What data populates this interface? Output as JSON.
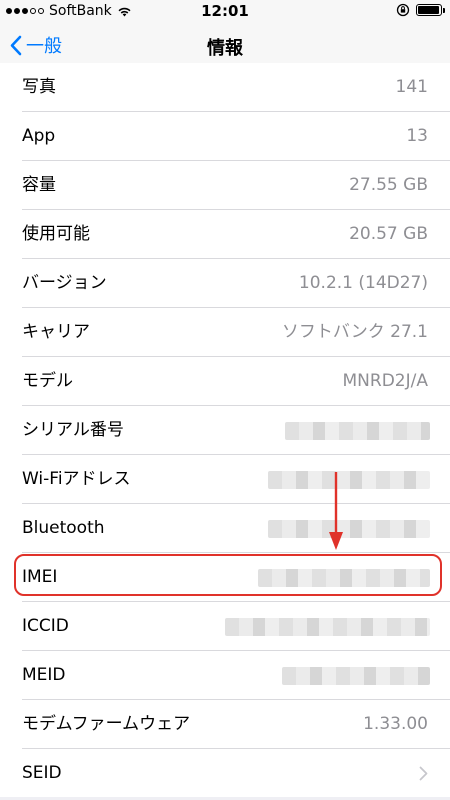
{
  "status_bar": {
    "carrier": "SoftBank",
    "time": "12:01",
    "battery_level": 0.95
  },
  "nav": {
    "back_label": "一般",
    "title": "情報"
  },
  "rows": [
    {
      "label": "写真",
      "value": "141"
    },
    {
      "label": "App",
      "value": "13"
    },
    {
      "label": "容量",
      "value": "27.55 GB"
    },
    {
      "label": "使用可能",
      "value": "20.57 GB"
    },
    {
      "label": "バージョン",
      "value": "10.2.1 (14D27)"
    },
    {
      "label": "キャリア",
      "value": "ソフトバンク 27.1"
    },
    {
      "label": "モデル",
      "value": "MNRD2J/A"
    },
    {
      "label": "シリアル番号",
      "value": ""
    },
    {
      "label": "Wi-Fiアドレス",
      "value": ""
    },
    {
      "label": "Bluetooth",
      "value": ""
    },
    {
      "label": "IMEI",
      "value": ""
    },
    {
      "label": "ICCID",
      "value": ""
    },
    {
      "label": "MEID",
      "value": ""
    },
    {
      "label": "モデムファームウェア",
      "value": "1.33.00"
    },
    {
      "label": "SEID",
      "value": ""
    }
  ],
  "colors": {
    "accent": "#007aff",
    "annotation": "#e0322a",
    "value_text": "#8e8e93"
  },
  "icons": {
    "back": "chevron-left-icon",
    "wifi": "wifi-icon",
    "lock_rotation": "orientation-lock-icon",
    "battery": "battery-icon",
    "disclosure": "chevron-right-icon",
    "annotation_arrow": "arrow-down-icon"
  }
}
